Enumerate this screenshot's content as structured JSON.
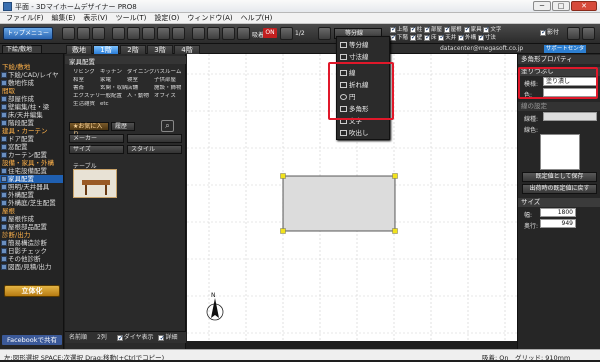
{
  "window": {
    "title": "平面 - 3Dマイホームデザイナー PRO8",
    "minimize": "─",
    "maximize": "□",
    "close": "✕"
  },
  "menu": [
    "ファイル(F)",
    "編集(E)",
    "表示(V)",
    "ツール(T)",
    "設定(O)",
    "ウィンドウ(A)",
    "ヘルプ(H)"
  ],
  "toolbar": {
    "top_button": "トップメニュー",
    "snap_label": "吸着",
    "snap_state": "ON",
    "ratio": "1/2",
    "line_tool": "等分線",
    "view_checks": [
      "上階",
      "下階",
      "柱",
      "壁",
      "部屋",
      "床",
      "天井",
      "屋根",
      "家具",
      "外構",
      "文字",
      "寸法",
      "記号",
      "点灯",
      "影付"
    ],
    "zoom_icons": [
      "zoom-in-icon",
      "zoom-out-icon",
      "fit-icon",
      "pan-icon"
    ]
  },
  "floor_tabs": {
    "tab_labels": [
      "敷地",
      "1階",
      "2階",
      "3階",
      "4階"
    ],
    "active": "1階"
  },
  "left_panel": {
    "dropdown": "下絵/敷地",
    "sections": [
      {
        "title": "下絵/敷地",
        "items": [
          "下絵/CAD/レイヤ",
          "敷地作成"
        ]
      },
      {
        "title": "間取",
        "items": [
          "部屋作成",
          "壁編集/柱・梁",
          "床/天井編集",
          "階段配置"
        ]
      },
      {
        "title": "建具・カーテン",
        "items": [
          "ドア配置",
          "窓配置",
          "カーテン配置"
        ]
      },
      {
        "title": "設備・家具・外構",
        "items": [
          "住宅設備配置",
          "家具配置",
          "照明/天井器具",
          "外構配置",
          "外構庭/芝生配置"
        ]
      },
      {
        "title": "屋根",
        "items": [
          "屋根作成",
          "屋根部品配置"
        ]
      },
      {
        "title": "診断/出力",
        "items": [
          "簡易構造診断",
          "日影チェック",
          "その他診断",
          "図面/見積/出力"
        ]
      }
    ],
    "selected": "家具配置",
    "render_button": "立体化",
    "facebook": "Facebookで共有"
  },
  "furniture_panel": {
    "header": "家具配置",
    "categories": [
      "リビング",
      "キッチン",
      "ダイニング",
      "バスルーム",
      "和室",
      "家電",
      "寝室",
      "子供部屋",
      "書斎",
      "玄関・収納",
      "店舗",
      "施設・飾物",
      "エクステリア",
      "一般配置",
      "人・動物",
      "オフィス",
      "生活雑貨",
      "etc"
    ],
    "favorite": "お気に入り",
    "history": "履歴",
    "filter_maker": "メーカー",
    "filter_size": "サイズ",
    "filter_style": "スタイル",
    "item_category": "テーブル",
    "bottom_items": [
      "名前順",
      "2列",
      "ダイヤ表示",
      "詳細"
    ]
  },
  "dropdown_menu": {
    "items": [
      "等分線",
      "寸法線",
      "線",
      "折れ線",
      "円",
      "多角形",
      "文字",
      "吹出し"
    ],
    "highlighted": [
      "線",
      "折れ線",
      "円",
      "多角形"
    ]
  },
  "canvas": {
    "email": "datacenter@megasoft.co.jp",
    "support": "サポートセンター",
    "compass": "N",
    "rectangle": {
      "width_mm": 1800,
      "height_mm": 949,
      "fill": "#dcdcdc"
    }
  },
  "right_panel": {
    "header": "多角形プロパティ",
    "section1": "塗りつぶし",
    "fill_pattern_label": "模様:",
    "fill_pattern_value": "塗り潰し",
    "color_label": "色:",
    "section2": "線の設定",
    "line_pattern_label": "線種:",
    "line_color_label": "線色:",
    "save_btn": "既定値として保存",
    "restore_btn": "出荷時の既定値に戻す",
    "size_section": "サイズ",
    "width_label": "幅:",
    "width_value": "1800",
    "depth_label": "奥行:",
    "depth_value": "949",
    "accent_red": "#e0182a"
  },
  "status": {
    "left": "左:図形選択 SPACE:次選択 Drag:移動(+Ctrlでコピー)",
    "right_label": "吸着: On",
    "grid_label": "グリッド: 910mm"
  }
}
